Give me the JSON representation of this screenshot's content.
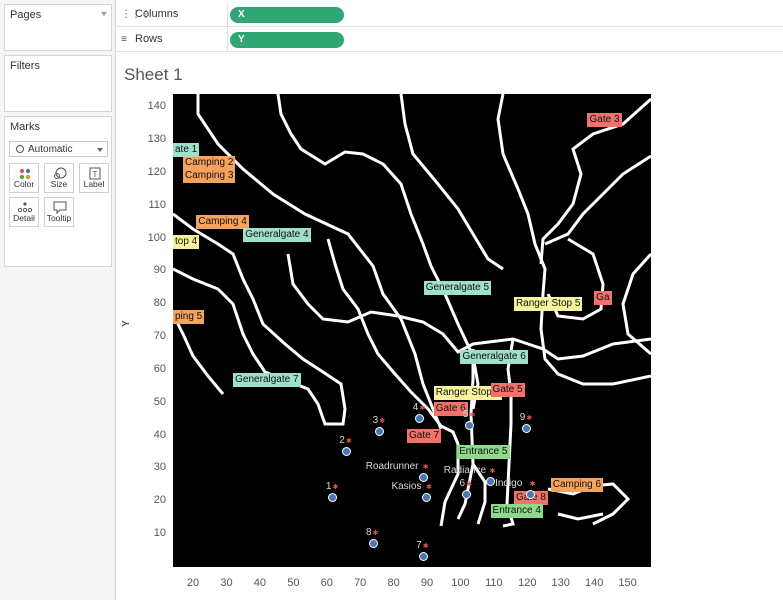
{
  "sidebar": {
    "pages": {
      "title": "Pages"
    },
    "filters": {
      "title": "Filters"
    },
    "marks": {
      "title": "Marks",
      "type": "Automatic",
      "buttons": [
        {
          "label": "Color",
          "icon": "color-icon"
        },
        {
          "label": "Size",
          "icon": "size-icon"
        },
        {
          "label": "Label",
          "icon": "label-icon"
        },
        {
          "label": "Detail",
          "icon": "detail-icon"
        },
        {
          "label": "Tooltip",
          "icon": "tooltip-icon"
        }
      ]
    }
  },
  "shelves": {
    "columns": {
      "label": "Columns",
      "pill": "X"
    },
    "rows": {
      "label": "Rows",
      "pill": "Y"
    }
  },
  "sheet": {
    "title": "Sheet 1"
  },
  "colors": {
    "pill": "#2ea775",
    "camping": "#f5a25d",
    "gate": "#f0726a",
    "generalgate": "#9fe0c8",
    "ranger": "#f7f39c",
    "entrance": "#8ed98a",
    "point": "#4a77b4"
  },
  "chart_data": {
    "type": "scatter",
    "xlabel": "",
    "ylabel": "Y",
    "xlim": [
      14,
      157
    ],
    "ylim": [
      0,
      144
    ],
    "x_ticks": [
      "20",
      "30",
      "40",
      "50",
      "60",
      "70",
      "80",
      "90",
      "100",
      "110",
      "120",
      "130",
      "140",
      "150"
    ],
    "y_ticks": [
      "10",
      "20",
      "30",
      "40",
      "50",
      "60",
      "70",
      "80",
      "90",
      "100",
      "110",
      "120",
      "130",
      "140"
    ],
    "labels": [
      {
        "text": "Camping 2",
        "x": 17,
        "y": 123,
        "cat": "camping"
      },
      {
        "text": "Camping 3",
        "x": 17,
        "y": 119,
        "cat": "camping"
      },
      {
        "text": "Gate 3",
        "x": 138,
        "y": 136,
        "cat": "gate"
      },
      {
        "text": "ate 1",
        "x": 0,
        "y": 127,
        "cat": "generalgate"
      },
      {
        "text": "Camping 4",
        "x": 21,
        "y": 105,
        "cat": "camping"
      },
      {
        "text": "top 4",
        "x": 0,
        "y": 99,
        "cat": "ranger"
      },
      {
        "text": "Generalgate 4",
        "x": 35,
        "y": 101,
        "cat": "generalgate"
      },
      {
        "text": "Generalgate 5",
        "x": 89,
        "y": 85,
        "cat": "generalgate"
      },
      {
        "text": "Ga",
        "x": 140,
        "y": 82,
        "cat": "gate"
      },
      {
        "text": "Ranger Stop 5",
        "x": 116,
        "y": 80,
        "cat": "ranger"
      },
      {
        "text": "ping 5",
        "x": 0,
        "y": 76,
        "cat": "camping"
      },
      {
        "text": "Generalgate 6",
        "x": 100,
        "y": 64,
        "cat": "generalgate"
      },
      {
        "text": "Generalgate 7",
        "x": 32,
        "y": 57,
        "cat": "generalgate"
      },
      {
        "text": "Ranger Stop 6",
        "x": 92,
        "y": 53,
        "cat": "ranger"
      },
      {
        "text": "Gate 5",
        "x": 109,
        "y": 54,
        "cat": "gate"
      },
      {
        "text": "Gate 6",
        "x": 92,
        "y": 48,
        "cat": "gate"
      },
      {
        "text": "Gate 7",
        "x": 84,
        "y": 40,
        "cat": "gate"
      },
      {
        "text": "Entrance 5",
        "x": 99,
        "y": 35,
        "cat": "entrance"
      },
      {
        "text": "Camping 6",
        "x": 127,
        "y": 25,
        "cat": "camping"
      },
      {
        "text": "Gate 8",
        "x": 116,
        "y": 21,
        "cat": "gate"
      },
      {
        "text": "Entrance 4",
        "x": 109,
        "y": 17,
        "cat": "entrance"
      }
    ],
    "points": [
      {
        "name": "1",
        "x": 62,
        "y": 21
      },
      {
        "name": "2",
        "x": 66,
        "y": 35
      },
      {
        "name": "3",
        "x": 76,
        "y": 41
      },
      {
        "name": "4",
        "x": 88,
        "y": 45
      },
      {
        "name": "5",
        "x": 103,
        "y": 43
      },
      {
        "name": "6",
        "x": 102,
        "y": 22
      },
      {
        "name": "7",
        "x": 89,
        "y": 3
      },
      {
        "name": "8",
        "x": 74,
        "y": 7
      },
      {
        "name": "9",
        "x": 120,
        "y": 42
      },
      {
        "name": "Roadrunner",
        "x": 89,
        "y": 27
      },
      {
        "name": "Kasios",
        "x": 90,
        "y": 21
      },
      {
        "name": "Radiance",
        "x": 109,
        "y": 26
      },
      {
        "name": "Indigo",
        "x": 121,
        "y": 22
      }
    ]
  }
}
